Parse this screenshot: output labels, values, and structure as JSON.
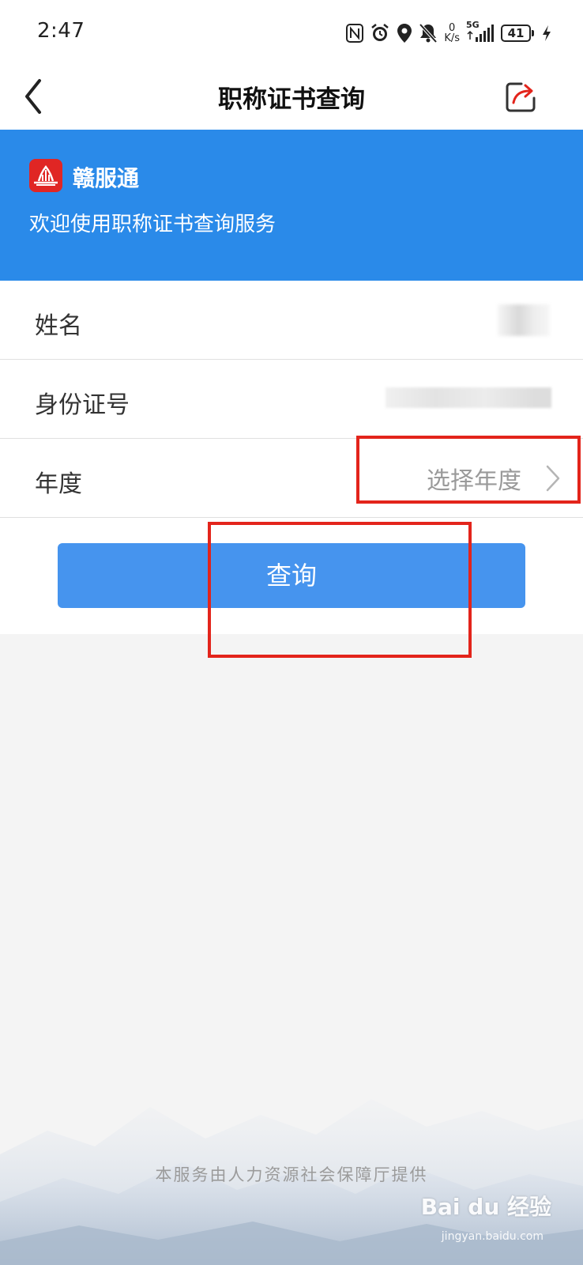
{
  "status_bar": {
    "time": "2:47",
    "net_speed_value": "0",
    "net_speed_unit": "K/s",
    "signal": "5G",
    "battery": "41",
    "icons": [
      "nfc-icon",
      "alarm-icon",
      "location-icon",
      "mute-icon",
      "signal-icon",
      "battery-icon",
      "charging-icon"
    ]
  },
  "nav": {
    "title": "职称证书查询",
    "icons": [
      "back-arrow-icon",
      "share-icon"
    ]
  },
  "banner": {
    "app_name": "赣服通",
    "subtitle": "欢迎使用职称证书查询服务",
    "color": "#2a8ae9"
  },
  "form": {
    "name_label": "姓名",
    "id_label": "身份证号",
    "year_label": "年度",
    "year_placeholder": "选择年度"
  },
  "query_button": {
    "label": "查询",
    "color": "#4694ee"
  },
  "footer": {
    "note": "本服务由人力资源社会保障厅提供"
  },
  "watermark": {
    "text": "Bai du 经验",
    "sub": "jingyan.baidu.com"
  },
  "annotation_color": "#e3241b"
}
